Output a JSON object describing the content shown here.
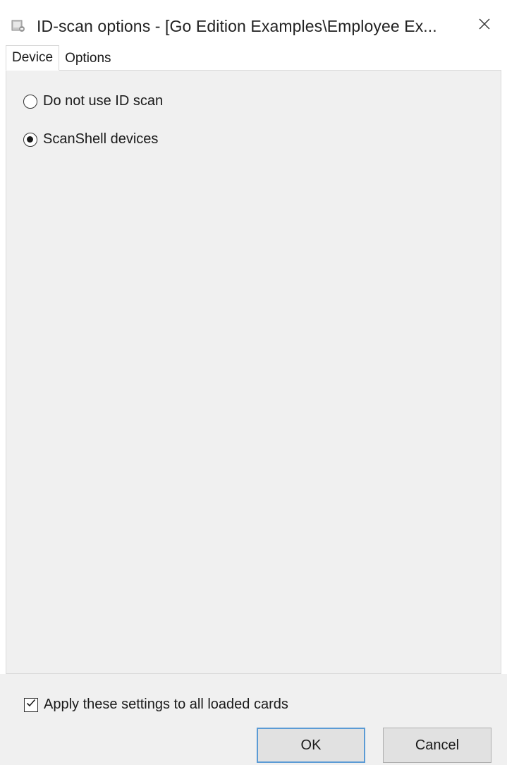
{
  "window": {
    "title": "ID-scan options - [Go Edition Examples\\Employee Ex..."
  },
  "icons": {
    "app": "app-icon",
    "close": "close-icon",
    "check": "check-icon"
  },
  "tabs": [
    {
      "label": "Device",
      "active": true
    },
    {
      "label": "Options",
      "active": false
    }
  ],
  "device": {
    "options": [
      {
        "label": "Do not use ID scan",
        "checked": false
      },
      {
        "label": "ScanShell devices",
        "checked": true
      }
    ]
  },
  "footer": {
    "apply_all": {
      "label": "Apply these settings to all loaded cards",
      "checked": true
    },
    "ok_label": "OK",
    "cancel_label": "Cancel"
  },
  "colors": {
    "panel_bg": "#f0f0f0",
    "button_bg": "#e1e1e1",
    "focus_border": "#5b9bd5"
  }
}
